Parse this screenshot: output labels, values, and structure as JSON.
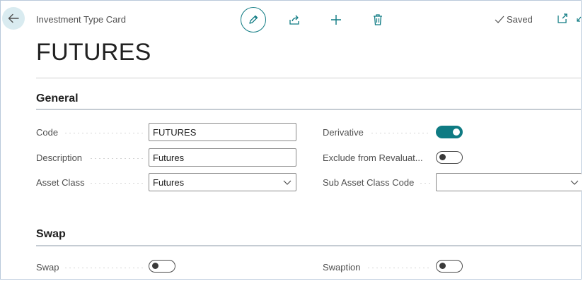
{
  "header": {
    "breadcrumb": "Investment Type Card",
    "status": "Saved",
    "title": "FUTURES"
  },
  "toolbar": {
    "back_icon": "arrow-left-icon",
    "edit_icon": "pencil-icon",
    "share_icon": "share-icon",
    "new_icon": "plus-icon",
    "delete_icon": "trash-icon",
    "saved_icon": "check-icon",
    "open_new_window_icon": "open-in-new-window-icon",
    "collapse_icon": "collapse-icon"
  },
  "sections": {
    "general": {
      "title": "General",
      "code_label": "Code",
      "code_value": "FUTURES",
      "description_label": "Description",
      "description_value": "Futures",
      "asset_class_label": "Asset Class",
      "asset_class_value": "Futures",
      "derivative_label": "Derivative",
      "derivative_value": true,
      "exclude_label": "Exclude from Revaluat...",
      "exclude_value": false,
      "sub_asset_label": "Sub Asset Class Code",
      "sub_asset_value": ""
    },
    "swap": {
      "title": "Swap",
      "swap_label": "Swap",
      "swap_value": false,
      "swaption_label": "Swaption",
      "swaption_value": false
    }
  },
  "colors": {
    "accent": "#0f7b83",
    "back_button_bg": "#d9ebf0"
  }
}
